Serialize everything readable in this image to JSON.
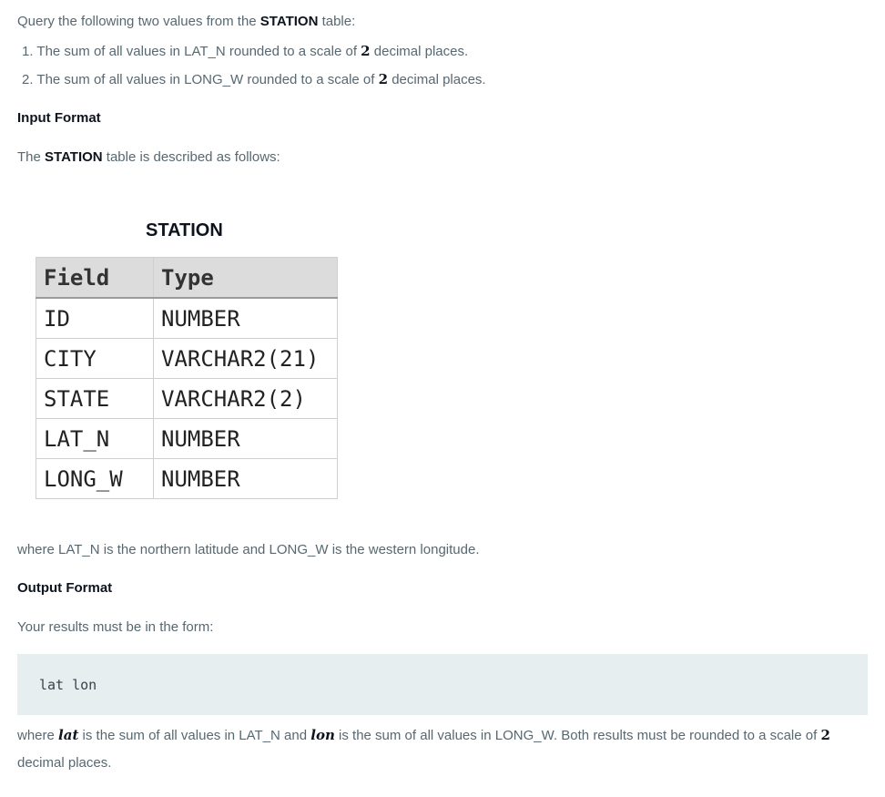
{
  "intro": {
    "prefix": "Query the following two values from the ",
    "table": "STATION",
    "suffix": " table:"
  },
  "items": [
    {
      "num": "1.",
      "text": "The sum of all values in LAT_N rounded to a scale of ",
      "value": "2",
      "tail": " decimal places."
    },
    {
      "num": "2.",
      "text": "The sum of all values in LONG_W rounded to a scale of ",
      "value": "2",
      "tail": " decimal places."
    }
  ],
  "input_heading": "Input Format",
  "input_desc": {
    "prefix": "The ",
    "table": "STATION",
    "suffix": " table is described as follows:"
  },
  "schema": {
    "title": "STATION",
    "headers": [
      "Field",
      "Type"
    ],
    "rows": [
      [
        "ID",
        "NUMBER"
      ],
      [
        "CITY",
        "VARCHAR2(21)"
      ],
      [
        "STATE",
        "VARCHAR2(2)"
      ],
      [
        "LAT_N",
        "NUMBER"
      ],
      [
        "LONG_W",
        "NUMBER"
      ]
    ]
  },
  "where_text": "where LAT_N is the northern latitude and LONG_W is the western longitude.",
  "output_heading": "Output Format",
  "output_desc": "Your results must be in the form:",
  "code": "lat lon",
  "final": {
    "p1": "where ",
    "v1": "lat",
    "p2": " is the sum of all values in LAT_N and ",
    "v2": "lon",
    "p3": " is the sum of all values in LONG_W. Both results must be rounded to a scale of ",
    "num": "2",
    "line2": "decimal places."
  }
}
